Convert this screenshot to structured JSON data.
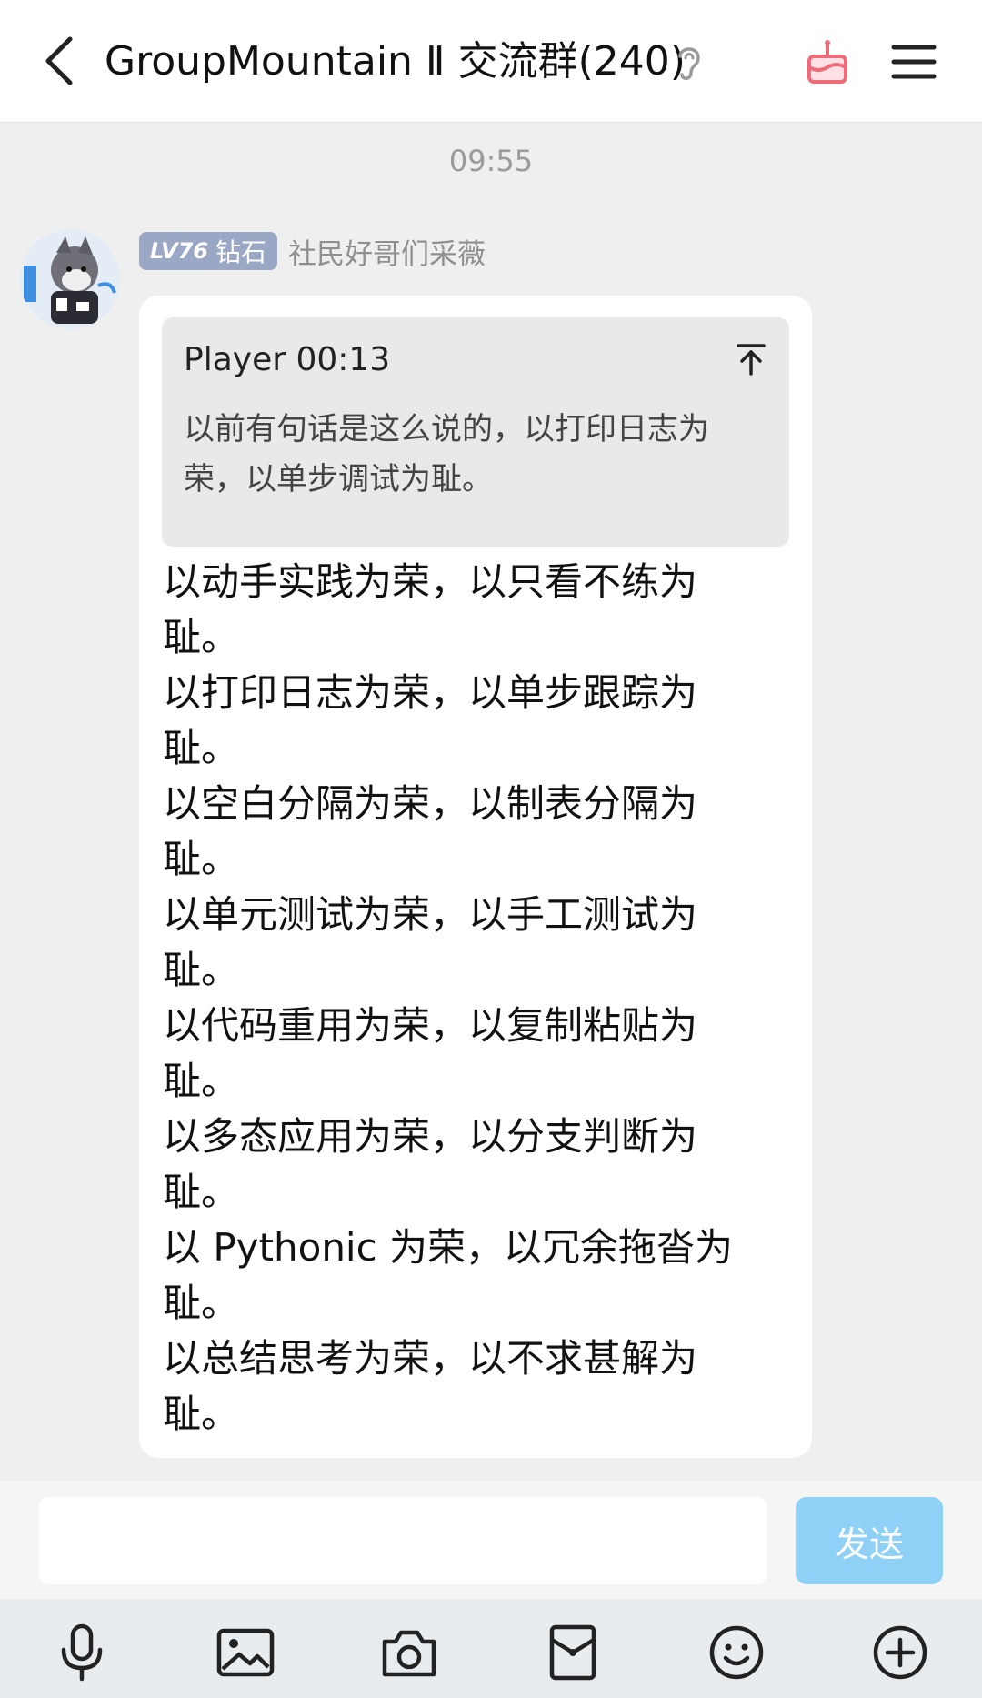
{
  "header": {
    "title": "GroupMountain Ⅱ 交流群(240)",
    "icons": [
      "back-arrow-icon",
      "ear-icon",
      "cake-icon",
      "menu-icon"
    ],
    "accent_color": "#f06b7a"
  },
  "timestamp": "09:55",
  "message": {
    "level_label": "LV76",
    "badge_label": "钻石",
    "sender_name": "社民好哥们采薇",
    "quote": {
      "author_time": "Player 00:13",
      "text": "以前有句话是这么说的，以打印日志为荣，以单步调试为耻。"
    },
    "lines": [
      "以动手实践为荣，以只看不练为",
      "耻。",
      "以打印日志为荣，以单步跟踪为",
      "耻。",
      "以空白分隔为荣，以制表分隔为",
      "耻。",
      "以单元测试为荣，以手工测试为",
      "耻。",
      "以代码重用为荣，以复制粘贴为",
      "耻。",
      "以多态应用为荣，以分支判断为",
      "耻。",
      "以 Pythonic 为荣，以冗余拖沓为",
      "耻。",
      "以总结思考为荣，以不求甚解为",
      "耻。"
    ]
  },
  "composer": {
    "input_value": "",
    "send_label": "发送",
    "send_color": "#8fd0f7"
  },
  "toolbar": {
    "icons": [
      "microphone-icon",
      "image-icon",
      "camera-icon",
      "red-packet-icon",
      "emoji-icon",
      "plus-icon"
    ]
  }
}
